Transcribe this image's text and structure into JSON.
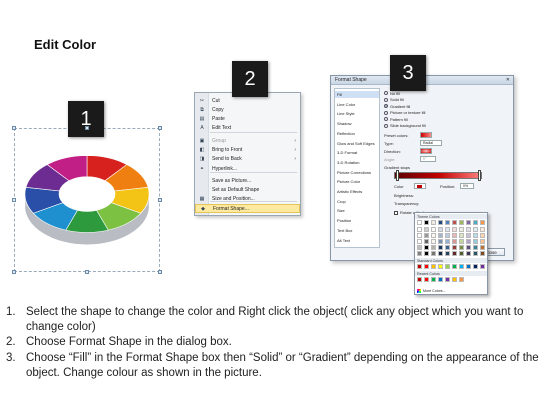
{
  "title": "Edit Color",
  "steps": [
    "1",
    "2",
    "3"
  ],
  "context_menu": {
    "items": [
      {
        "icon": "scissors-icon",
        "glyph": "✂",
        "label": "Cut",
        "submenu": false,
        "disabled": false
      },
      {
        "icon": "copy-icon",
        "glyph": "⧉",
        "label": "Copy",
        "submenu": false,
        "disabled": false
      },
      {
        "icon": "paste-icon",
        "glyph": "▤",
        "label": "Paste",
        "submenu": false,
        "disabled": false
      },
      {
        "icon": "edit-text-icon",
        "glyph": "A",
        "label": "Edit Text",
        "submenu": false,
        "disabled": false
      },
      {
        "icon": "group-icon",
        "glyph": "▣",
        "label": "Group",
        "submenu": true,
        "disabled": true
      },
      {
        "icon": "bring-front-icon",
        "glyph": "◧",
        "label": "Bring to Front",
        "submenu": true,
        "disabled": false
      },
      {
        "icon": "send-back-icon",
        "glyph": "◨",
        "label": "Send to Back",
        "submenu": true,
        "disabled": false
      },
      {
        "icon": "hyperlink-icon",
        "glyph": "⚭",
        "label": "Hyperlink...",
        "submenu": false,
        "disabled": false
      },
      {
        "icon": "save-picture-icon",
        "glyph": "",
        "label": "Save as Picture...",
        "submenu": false,
        "disabled": false
      },
      {
        "icon": "default-shape-icon",
        "glyph": "",
        "label": "Set as Default Shape",
        "submenu": false,
        "disabled": false
      },
      {
        "icon": "size-position-icon",
        "glyph": "▦",
        "label": "Size and Position...",
        "submenu": false,
        "disabled": false
      },
      {
        "icon": "format-shape-icon",
        "glyph": "◆",
        "label": "Format Shape...",
        "submenu": false,
        "disabled": false,
        "highlighted": true
      }
    ]
  },
  "format_dialog": {
    "title": "Format Shape",
    "nav": [
      "Fill",
      "Line Color",
      "Line Style",
      "Shadow",
      "Reflection",
      "Glow and Soft Edges",
      "3-D Format",
      "3-D Rotation",
      "Picture Corrections",
      "Picture Color",
      "Artistic Effects",
      "Crop",
      "Size",
      "Position",
      "Text Box",
      "Alt Text"
    ],
    "fill_options": [
      "No fill",
      "Solid fill",
      "Gradient fill",
      "Picture or texture fill",
      "Pattern fill",
      "Slide background fill"
    ],
    "selected_fill": "Gradient fill",
    "preset_colors_label": "Preset colors:",
    "type_label": "Type:",
    "type_value": "Radial",
    "direction_label": "Direction:",
    "angle_label": "Angle:",
    "angle_value": "0°",
    "gradient_stops_label": "Gradient stops",
    "color_label": "Color",
    "position_label": "Position:",
    "position_value": "0%",
    "brightness_label": "Brightness:",
    "transparency_label": "Transparency:",
    "rotate_label": "Rotate with shape",
    "close_label": "Close"
  },
  "palette": {
    "theme_header": "Theme Colors",
    "standard_header": "Standard Colors",
    "recent_header": "Recent Colors",
    "more_label": "More Colors...",
    "theme_top": [
      "#ffffff",
      "#000000",
      "#eeece1",
      "#1f497d",
      "#4f81bd",
      "#c0504d",
      "#9bbb59",
      "#8064a2",
      "#4bacc6",
      "#f79646"
    ],
    "standard": [
      "#c00000",
      "#ff0000",
      "#ffc000",
      "#ffff00",
      "#92d050",
      "#00b050",
      "#00b0f0",
      "#0070c0",
      "#002060",
      "#7030a0"
    ],
    "recent": [
      "#c00000",
      "#ff0000",
      "#00b050",
      "#0070c0",
      "#7030a0",
      "#ffc000",
      "#f79646"
    ]
  },
  "instructions": [
    {
      "num": "1.",
      "text": "Select the shape to change the color and Right click the object( click any object which you want to change color)"
    },
    {
      "num": "2.",
      "text": "Choose Format Shape in the dialog box."
    },
    {
      "num": "3.",
      "text": "Choose “Fill” in the Format Shape box then “Solid” or “Gradient” depending on the appearance of the object. Change colour as shown in the picture."
    }
  ],
  "ring_colors": [
    "#d6211f",
    "#f07f12",
    "#f3c316",
    "#7cc142",
    "#2e9a3e",
    "#1e8fcf",
    "#2a4fa8",
    "#6d2c91",
    "#c21f86"
  ]
}
